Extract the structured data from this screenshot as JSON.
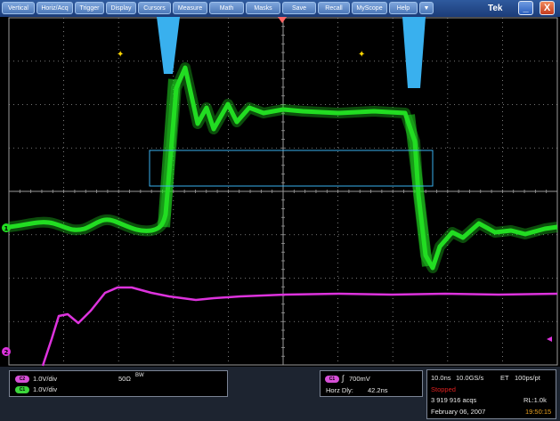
{
  "menu": {
    "items": [
      "Vertical",
      "Horiz/Acq",
      "Trigger",
      "Display",
      "Cursors",
      "Measure",
      "Math",
      "Masks",
      "Save",
      "Recall",
      "MyScope",
      "Help"
    ],
    "dropdown_glyph": "▼",
    "brand": "Tek",
    "minimize_glyph": "_",
    "close_glyph": "X"
  },
  "display": {
    "grid_color": "#9a9a9a",
    "ch1_color": "#22dd22",
    "ch2_color": "#dd33dd",
    "cursor_color": "#39b0ee",
    "trigger_arrow_color": "#ff6666",
    "marker_color": "#ffd700",
    "ch1_marker": "1",
    "ch2_marker": "2"
  },
  "status": {
    "ch2_badge": "C2",
    "ch2_scale": "1.0V/div",
    "ch1_badge": "C1",
    "ch1_scale": "1.0V/div",
    "termination": "50Ω",
    "bw_symbol": "BW",
    "trigger_badge": "C1",
    "trigger_level": "700mV",
    "trigger_slope_glyph": "∫",
    "horz_delay_label": "Horz Dly:",
    "horz_delay_value": "42.2ns",
    "time_per_div": "10.0ns",
    "sample_rate": "10.0GS/s",
    "et": "ET",
    "resolution": "100ps/pt",
    "acq_state": "Stopped",
    "acq_count": "3 919 916 acqs",
    "record_length": "RL:1.0k",
    "date": "February 06, 2007",
    "time": "19:50:15"
  }
}
